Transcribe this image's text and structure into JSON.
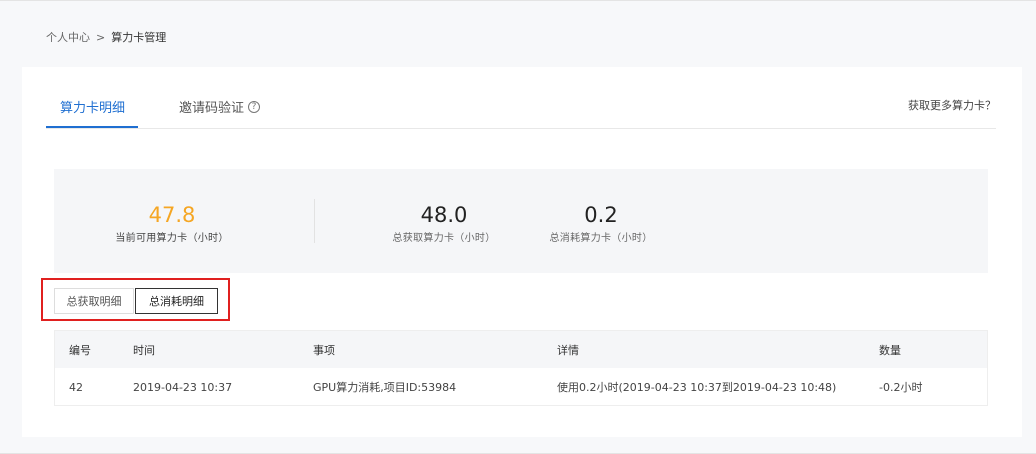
{
  "breadcrumb": {
    "home": "个人中心",
    "separator": ">",
    "current": "算力卡管理"
  },
  "tabs": {
    "detail": "算力卡明细",
    "invite": "邀请码验证",
    "invite_help": "?",
    "more_link": "获取更多算力卡？"
  },
  "stats": {
    "available": {
      "value": "47.8",
      "label": "当前可用算力卡（小时）"
    },
    "total": {
      "value": "48.0",
      "label": "总获取算力卡（小时）"
    },
    "used": {
      "value": "0.2",
      "label": "总消耗算力卡（小时）"
    }
  },
  "segments": {
    "income": "总获取明细",
    "usage": "总消耗明细"
  },
  "table": {
    "headers": [
      "编号",
      "时间",
      "事项",
      "详情",
      "数量"
    ],
    "rows": [
      [
        "42",
        "2019-04-23 10:37",
        "GPU算力消耗,项目ID:53984",
        "使用0.2小时(2019-04-23 10:37到2019-04-23 10:48)",
        "-0.2小时"
      ]
    ]
  },
  "colors": {
    "accent": "#1f6fd1",
    "available_value": "#f5a623",
    "highlight_border": "#e0201f"
  }
}
